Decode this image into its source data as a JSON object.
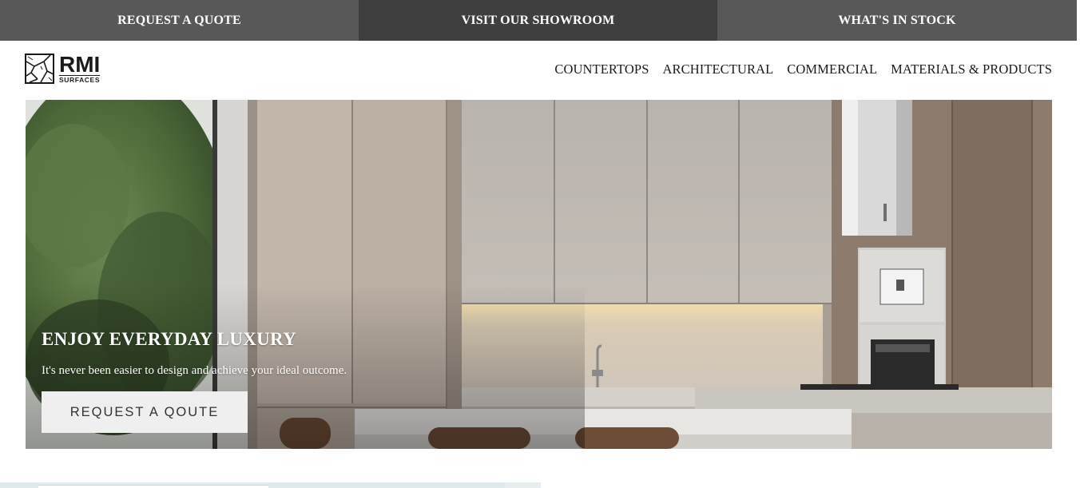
{
  "topbar": {
    "items": [
      {
        "label": "REQUEST A QUOTE"
      },
      {
        "label": "VISIT OUR SHOWROOM"
      },
      {
        "label": "WHAT'S IN STOCK"
      }
    ]
  },
  "logo": {
    "main_text": "RMI",
    "sub_text": "SURFACES"
  },
  "nav": {
    "items": [
      {
        "label": "COUNTERTOPS"
      },
      {
        "label": "ARCHITECTURAL"
      },
      {
        "label": "COMMERCIAL"
      },
      {
        "label": "MATERIALS & PRODUCTS"
      }
    ]
  },
  "hero": {
    "title": "ENJOY EVERYDAY LUXURY",
    "subtitle": "It's never been easier to design and achieve your ideal outcome.",
    "button_label": "REQUEST A QOUTE"
  },
  "colors": {
    "topbar_dark": "#3f3f3f",
    "topbar_mid": "#585858",
    "button_bg": "#efefef"
  }
}
